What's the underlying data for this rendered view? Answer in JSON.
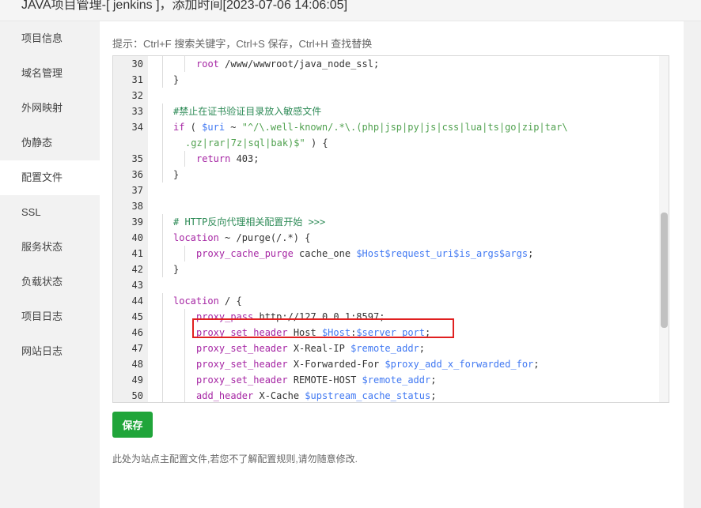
{
  "window": {
    "title": "JAVA项目管理-[ jenkins ]，添加时间[2023-07-06 14:06:05]"
  },
  "sidebar": {
    "items": [
      {
        "label": "项目信息"
      },
      {
        "label": "域名管理"
      },
      {
        "label": "外网映射"
      },
      {
        "label": "伪静态"
      },
      {
        "label": "配置文件",
        "active": true
      },
      {
        "label": "SSL"
      },
      {
        "label": "服务状态"
      },
      {
        "label": "负载状态"
      },
      {
        "label": "项目日志"
      },
      {
        "label": "网站日志"
      }
    ]
  },
  "main": {
    "hint": "提示：Ctrl+F 搜索关键字，Ctrl+S 保存，Ctrl+H 查找替换",
    "save_label": "保存",
    "note": "此处为站点主配置文件,若您不了解配置规则,请勿随意修改.",
    "highlighted_line": "46"
  },
  "editor": {
    "lines": [
      {
        "num": "30",
        "indent": 2,
        "tokens": [
          [
            "kw",
            "root"
          ],
          [
            "plain",
            " /www/wwwroot/java_node_ssl;"
          ]
        ]
      },
      {
        "num": "31",
        "indent": 1,
        "tokens": [
          [
            "plain",
            "}"
          ]
        ]
      },
      {
        "num": "32",
        "indent": 0,
        "tokens": []
      },
      {
        "num": "33",
        "indent": 1,
        "tokens": [
          [
            "com",
            "#禁止在证书验证目录放入敏感文件"
          ]
        ]
      },
      {
        "num": "34",
        "indent": 1,
        "tokens": [
          [
            "kw",
            "if"
          ],
          [
            "plain",
            " ( "
          ],
          [
            "var",
            "$uri"
          ],
          [
            "plain",
            " ~ "
          ],
          [
            "str",
            "\"^/\\.well-known/.*\\.(php|jsp|py|js|css|lua|ts|go|zip|tar\\"
          ]
        ]
      },
      {
        "num": "",
        "indent": 1,
        "extra": 1,
        "tokens": [
          [
            "str",
            ".gz|rar|7z|sql|bak)$\""
          ],
          [
            "plain",
            " ) {"
          ]
        ]
      },
      {
        "num": "35",
        "indent": 2,
        "tokens": [
          [
            "kw",
            "return"
          ],
          [
            "plain",
            " 403;"
          ]
        ]
      },
      {
        "num": "36",
        "indent": 1,
        "tokens": [
          [
            "plain",
            "}"
          ]
        ]
      },
      {
        "num": "37",
        "indent": 0,
        "tokens": []
      },
      {
        "num": "38",
        "indent": 0,
        "tokens": []
      },
      {
        "num": "39",
        "indent": 1,
        "tokens": [
          [
            "com",
            "# HTTP反向代理相关配置开始 >>>"
          ]
        ]
      },
      {
        "num": "40",
        "indent": 1,
        "tokens": [
          [
            "kw",
            "location"
          ],
          [
            "plain",
            " ~ /purge(/.*) {"
          ]
        ]
      },
      {
        "num": "41",
        "indent": 2,
        "tokens": [
          [
            "kw",
            "proxy_cache_purge"
          ],
          [
            "plain",
            " cache_one "
          ],
          [
            "var",
            "$Host$request_uri$is_args$args"
          ],
          [
            "plain",
            ";"
          ]
        ]
      },
      {
        "num": "42",
        "indent": 1,
        "tokens": [
          [
            "plain",
            "}"
          ]
        ]
      },
      {
        "num": "43",
        "indent": 0,
        "tokens": []
      },
      {
        "num": "44",
        "indent": 1,
        "tokens": [
          [
            "kw",
            "location"
          ],
          [
            "plain",
            " / {"
          ]
        ]
      },
      {
        "num": "45",
        "indent": 2,
        "tokens": [
          [
            "kw",
            "proxy_pass"
          ],
          [
            "plain",
            " http://127.0.0.1:8597;"
          ]
        ]
      },
      {
        "num": "46",
        "indent": 2,
        "tokens": [
          [
            "kw",
            "proxy_set_header"
          ],
          [
            "plain",
            " Host "
          ],
          [
            "var",
            "$Host"
          ],
          [
            "plain",
            ":"
          ],
          [
            "var",
            "$server_port"
          ],
          [
            "plain",
            ";"
          ]
        ]
      },
      {
        "num": "47",
        "indent": 2,
        "tokens": [
          [
            "kw",
            "proxy_set_header"
          ],
          [
            "plain",
            " X-Real-IP "
          ],
          [
            "var",
            "$remote_addr"
          ],
          [
            "plain",
            ";"
          ]
        ]
      },
      {
        "num": "48",
        "indent": 2,
        "tokens": [
          [
            "kw",
            "proxy_set_header"
          ],
          [
            "plain",
            " X-Forwarded-For "
          ],
          [
            "var",
            "$proxy_add_x_forwarded_for"
          ],
          [
            "plain",
            ";"
          ]
        ]
      },
      {
        "num": "49",
        "indent": 2,
        "tokens": [
          [
            "kw",
            "proxy_set_header"
          ],
          [
            "plain",
            " REMOTE-HOST "
          ],
          [
            "var",
            "$remote_addr"
          ],
          [
            "plain",
            ";"
          ]
        ]
      },
      {
        "num": "50",
        "indent": 2,
        "tokens": [
          [
            "kw",
            "add_header"
          ],
          [
            "plain",
            " X-Cache "
          ],
          [
            "var",
            "$upstream_cache_status"
          ],
          [
            "plain",
            ";"
          ]
        ]
      }
    ]
  },
  "colors": {
    "accent_green": "#20a53a",
    "highlight_red": "#e02020",
    "keyword": "#a626a4",
    "variable": "#4078f2",
    "string": "#50a14f",
    "comment": "#2e8b57"
  }
}
